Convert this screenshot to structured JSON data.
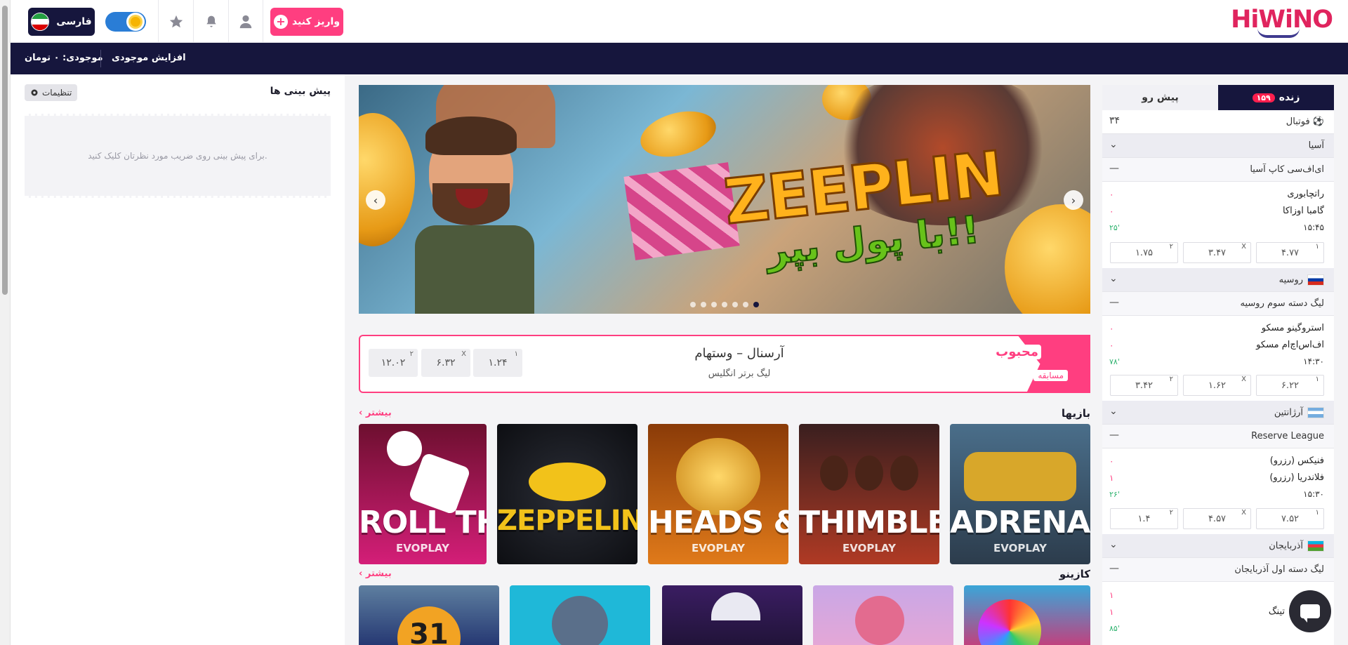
{
  "header": {
    "logo": "HiWiNO",
    "deposit_label": "واریز کنید",
    "language_label": "فارسی"
  },
  "navbar": {
    "balance": "موجودی: ۰ تومان",
    "increase_balance": "افزایش موجودی"
  },
  "predictions": {
    "title": "پیش بینی ها",
    "settings_label": "تنظیمات",
    "empty_text": "برای پیش بینی روی ضریب مورد نظرتان کلیک کنید."
  },
  "banner": {
    "brand": "ZEEPLIN",
    "tagline": "با پول بپر!!",
    "slide_count": 7,
    "active_slide": 1
  },
  "favorite": {
    "title": "محبوب",
    "subtitle": "مسابقه",
    "match": "آرسنال – وستهام",
    "league": "لیگ برتر انگلیس",
    "odds": [
      {
        "label": "۱",
        "value": "۱.۲۴"
      },
      {
        "label": "X",
        "value": "۶.۳۲"
      },
      {
        "label": "۲",
        "value": "۱۲.۰۲"
      }
    ]
  },
  "games": {
    "title": "بازیها",
    "more": "بیشتر",
    "items": [
      {
        "name": "ADRENALINE RUSH",
        "provider": "EVOPLAY",
        "color": "#4a6e8a"
      },
      {
        "name": "THIMBLE",
        "provider": "EVOPLAY",
        "color": "#b03a24"
      },
      {
        "name": "HEADS & TAILS",
        "provider": "EVOPLAY",
        "color": "#c2620f"
      },
      {
        "name": "ZEPPELIN",
        "provider": "",
        "color": "#14161c"
      },
      {
        "name": "ROLL THE DICE",
        "provider": "EVOPLAY",
        "color": "#c2176b"
      }
    ]
  },
  "casino": {
    "title": "کازینو",
    "more": "بیشتر",
    "items": [
      {
        "name": "",
        "color": "#d8306f"
      },
      {
        "name": "",
        "color": "#e9a7d4"
      },
      {
        "name": "",
        "color": "#2b1d52"
      },
      {
        "name": "",
        "color": "#1aa6c9"
      },
      {
        "name": "31",
        "color": "#1c2c6b"
      }
    ]
  },
  "sports": {
    "tab_live": "زنده",
    "live_count": "۱۵۹",
    "tab_prematch": "پیش رو",
    "sport_name": "فوتبال",
    "sport_count": "۳۴",
    "groups": [
      {
        "region": "آسیا",
        "league": "ای‌اف‌سی کاپ آسیا",
        "home": "راتچابوری",
        "away": "گامبا اوزاکا",
        "home_score": "۰",
        "away_score": "۰",
        "time": "۱۵:۴۵",
        "minute": "۲۵'",
        "odds": [
          {
            "label": "۱",
            "value": "۴.۷۷"
          },
          {
            "label": "X",
            "value": "۳.۴۷"
          },
          {
            "label": "۲",
            "value": "۱.۷۵"
          }
        ]
      },
      {
        "region": "روسیه",
        "league": "لیگ دسته سوم روسیه",
        "home": "استروگینو مسکو",
        "away": "اف‌اس‌اچ‌ام مسکو",
        "home_score": "۰",
        "away_score": "۰",
        "time": "۱۴:۳۰",
        "minute": "۷۸'",
        "odds": [
          {
            "label": "۱",
            "value": "۶.۲۲"
          },
          {
            "label": "X",
            "value": "۱.۶۲"
          },
          {
            "label": "۲",
            "value": "۳.۴۲"
          }
        ]
      },
      {
        "region": "آرژانتین",
        "league": "Reserve League",
        "home": "فنیکس (رزرو)",
        "away": "فلاندریا (رزرو)",
        "home_score": "۰",
        "away_score": "۱",
        "time": "۱۵:۳۰",
        "minute": "۲۶'",
        "odds": [
          {
            "label": "۱",
            "value": "۷.۵۲"
          },
          {
            "label": "X",
            "value": "۴.۵۷"
          },
          {
            "label": "۲",
            "value": "۱.۴"
          }
        ]
      },
      {
        "region": "آذربایجان",
        "league": "لیگ دسته اول آذربایجان",
        "home": "",
        "away": "تینگ",
        "home_score": "۱",
        "away_score": "۱",
        "time": "",
        "minute": "۸۵'"
      }
    ]
  }
}
